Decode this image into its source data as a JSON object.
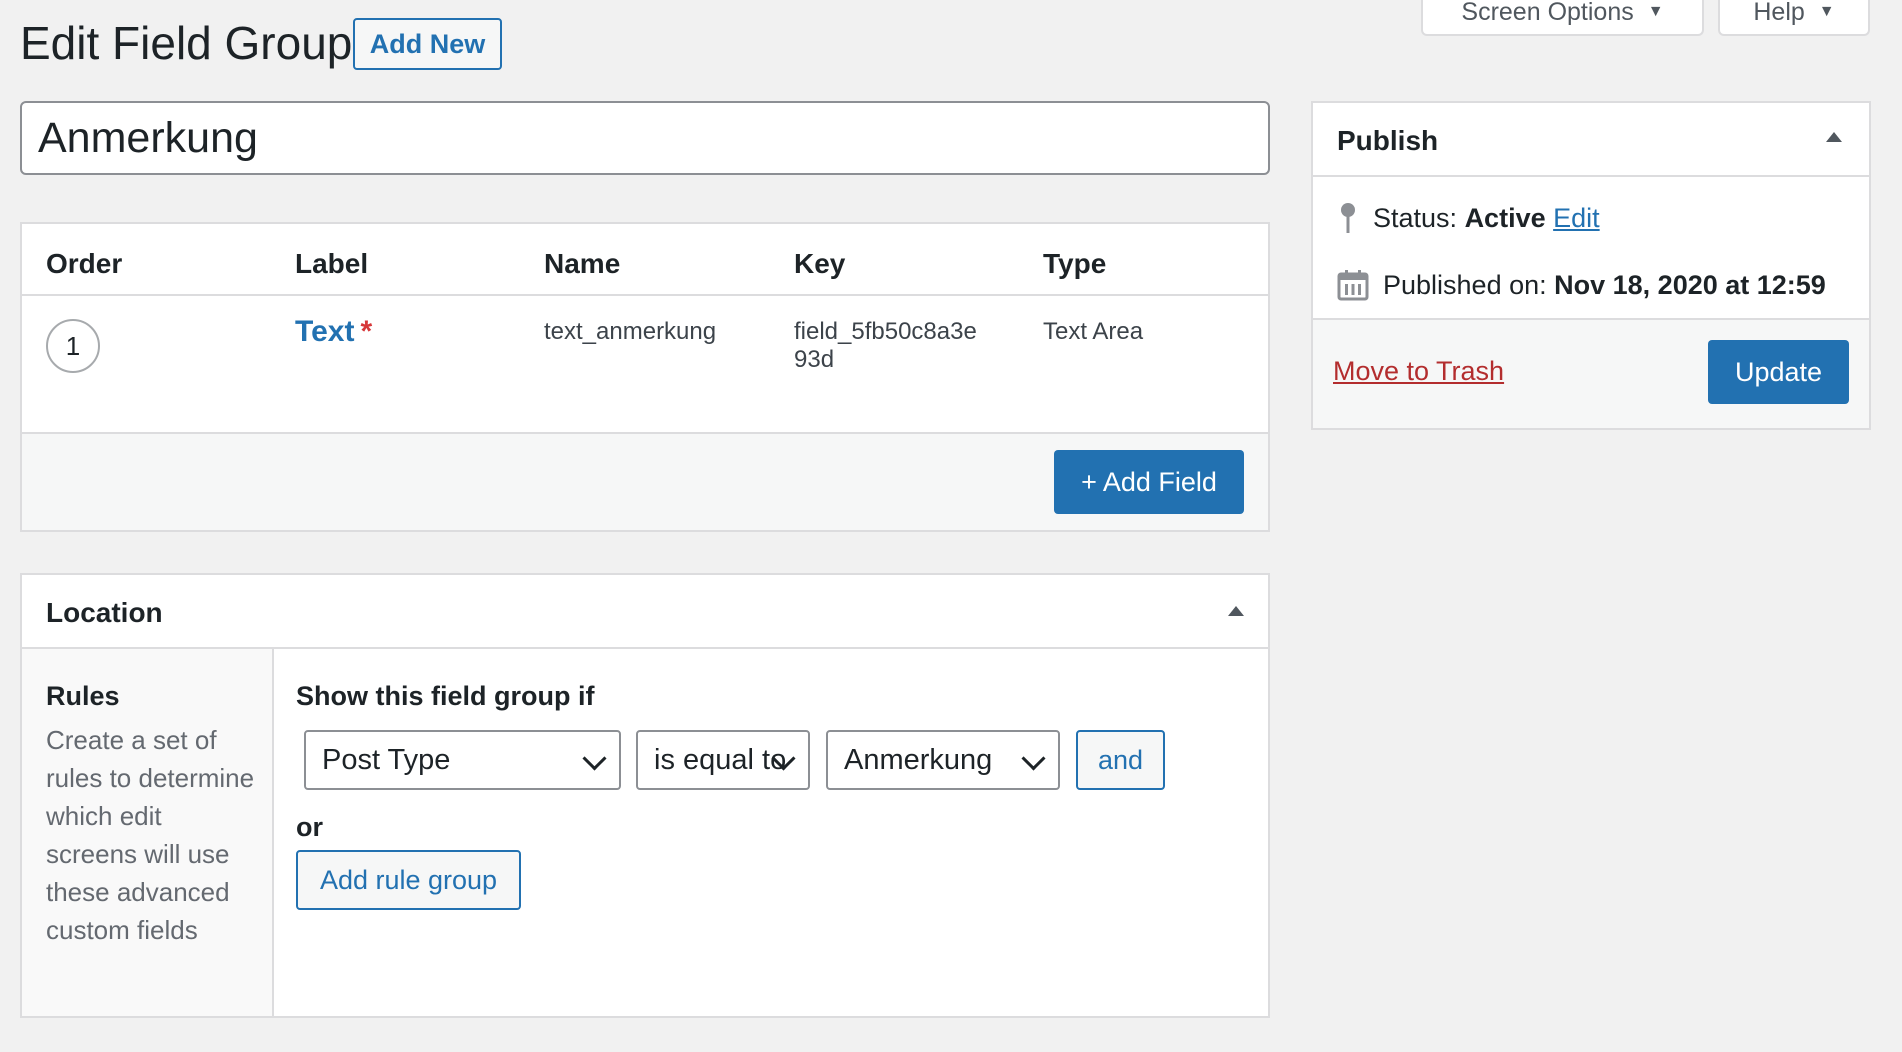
{
  "header": {
    "title": "Edit Field Group",
    "add_new_label": "Add New",
    "screen_options_label": "Screen Options",
    "help_label": "Help"
  },
  "title_input": {
    "value": "Anmerkung"
  },
  "fields": {
    "columns": [
      "Order",
      "Label",
      "Name",
      "Key",
      "Type"
    ],
    "rows": [
      {
        "order": "1",
        "label": "Text",
        "required": "*",
        "name": "text_anmerkung",
        "key_line1": "field_5fb50c8a3e",
        "key_line2": "93d",
        "type": "Text Area"
      }
    ],
    "add_field_label": "+ Add Field"
  },
  "location": {
    "title": "Location",
    "rules_title": "Rules",
    "rules_desc": "Create a set of rules to determine which edit screens will use these advanced custom fields",
    "show_if": "Show this field group if",
    "param": "Post Type",
    "operator": "is equal to",
    "value": "Anmerkung",
    "and_label": "and",
    "or_label": "or",
    "add_rule_group_label": "Add rule group"
  },
  "publish": {
    "title": "Publish",
    "status_label": "Status:",
    "status_value": "Active",
    "status_edit": "Edit",
    "published_label": "Published on:",
    "published_value": "Nov 18, 2020 at 12:59",
    "trash_label": "Move to Trash",
    "update_label": "Update"
  },
  "colors": {
    "primary": "#2271b1",
    "danger": "#b32d2e",
    "required": "#d63638",
    "background": "#f1f1f1"
  }
}
